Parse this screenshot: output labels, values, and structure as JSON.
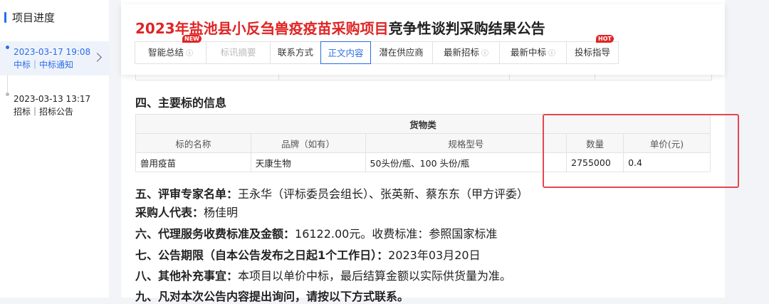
{
  "sidebar": {
    "title": "项目进度",
    "items": [
      {
        "date": "2023-03-17 19:08",
        "type": "中标｜中标通知",
        "active": true
      },
      {
        "date": "2023-03-13 13:17",
        "type": "招标｜招标公告",
        "active": false
      }
    ]
  },
  "header": {
    "title_highlight": "2023年盐池县小反刍兽疫疫苗采购项目",
    "title_rest": "竞争性谈判采购结果公告",
    "tabs": [
      {
        "label": "智能总结",
        "badge": "NEW",
        "circle": "?"
      },
      {
        "label": "标讯摘要",
        "disabled": true
      },
      {
        "label": "联系方式"
      },
      {
        "label": "正文内容",
        "active": true
      },
      {
        "label": "潜在供应商"
      },
      {
        "label": "最新招标",
        "circle": "?"
      },
      {
        "label": "最新中标",
        "circle": "?"
      },
      {
        "label": "投标指导",
        "badge": "HOT"
      }
    ]
  },
  "content": {
    "section4_title": "四、主要标的信息",
    "table": {
      "group_header": "货物类",
      "columns": [
        "标的名称",
        "品牌（如有）",
        "规格型号",
        "数量",
        "单价(元)"
      ],
      "rows": [
        [
          "兽用疫苗",
          "天康生物",
          "50头份/瓶、100 头份/瓶",
          "2755000",
          "0.4"
        ]
      ]
    },
    "paragraphs": [
      {
        "label": "五、评审专家名单：",
        "text": "王永华（评标委员会组长）、张英新、蔡东东（甲方评委）"
      },
      {
        "label": "采购人代表：",
        "text": "杨佳明"
      },
      {
        "label": "六、代理服务收费标准及金额：",
        "text": "16122.00元。收费标准：参照国家标准"
      },
      {
        "label": "七、公告期限（自本公告发布之日起1个工作日）：",
        "text": "2023年03月20日"
      },
      {
        "label": "八、其他补充事宜：",
        "text": "本项目以单价中标，最后结算金额以实际供货量为准。"
      },
      {
        "label": "九、凡对本次公告内容提出询问，请按以下方式联系。",
        "text": ""
      }
    ]
  },
  "colors": {
    "accent": "#2b6ce8",
    "title_red": "#e02424",
    "highlight_border": "#e64651"
  }
}
